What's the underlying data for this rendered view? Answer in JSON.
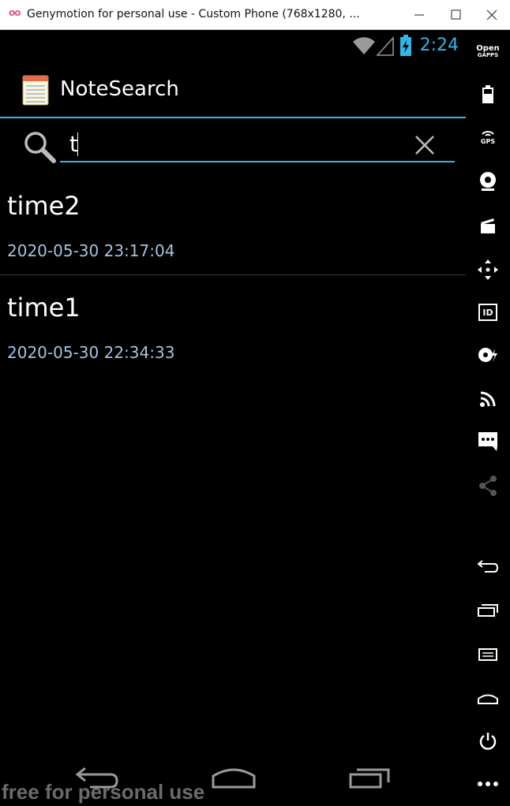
{
  "window": {
    "title": "Genymotion for personal use - Custom Phone (768x1280, ...",
    "logo_text": "oo"
  },
  "statusbar": {
    "time": "2:24"
  },
  "app": {
    "title": "NoteSearch"
  },
  "search": {
    "value": "t"
  },
  "notes": [
    {
      "title": "time2",
      "date": "2020-05-30 23:17:04"
    },
    {
      "title": "time1",
      "date": "2020-05-30 22:34:33"
    }
  ],
  "watermark": "free for personal use",
  "sidebar": {
    "opengapps_line1": "Open",
    "opengapps_line2": "GAPPS",
    "gps_label": "GPS",
    "id_label": "ID"
  },
  "colors": {
    "accent": "#33b5e5",
    "date_text": "#a6c3df",
    "background": "#000000"
  }
}
